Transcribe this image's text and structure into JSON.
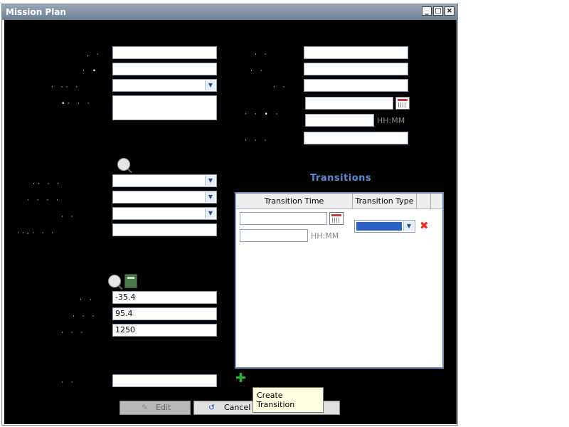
{
  "window": {
    "title": "Mission Plan",
    "controls": {
      "minimize": "_",
      "maximize": "□",
      "close": "×"
    }
  },
  "left_fields": [
    {
      "value": ""
    },
    {
      "value": ""
    },
    {
      "value": ""
    },
    {
      "value": ""
    }
  ],
  "right_fields": [
    {
      "value": ""
    },
    {
      "value": ""
    },
    {
      "value": ""
    },
    {
      "value": ""
    },
    {
      "value": ""
    },
    {
      "value": ""
    }
  ],
  "time_format": "HH:MM",
  "middle_selects": [
    {
      "value": ""
    },
    {
      "value": ""
    },
    {
      "value": ""
    }
  ],
  "middle_text": "",
  "coordinates": {
    "lat": "-35.4",
    "lon": "95.4",
    "alt": "1250"
  },
  "bottom_field": "",
  "transitions": {
    "heading": "Transitions",
    "columns": [
      "Transition Time",
      "Transition Type"
    ],
    "row": {
      "date": "",
      "time": "",
      "time_format": "HH:MM"
    }
  },
  "buttons": {
    "edit": "Edit",
    "cancel": "Cancel"
  },
  "tooltip": "Create Transition",
  "icons": {
    "calendar": "calendar-icon",
    "search": "magnifier-icon",
    "calculator": "calculator-icon",
    "delete": "delete-icon",
    "add": "add-icon"
  },
  "colors": {
    "titlebar": "#6f8296",
    "background": "#000000",
    "accent": "#5b8bd8",
    "selected_option": "#2a62c8"
  }
}
